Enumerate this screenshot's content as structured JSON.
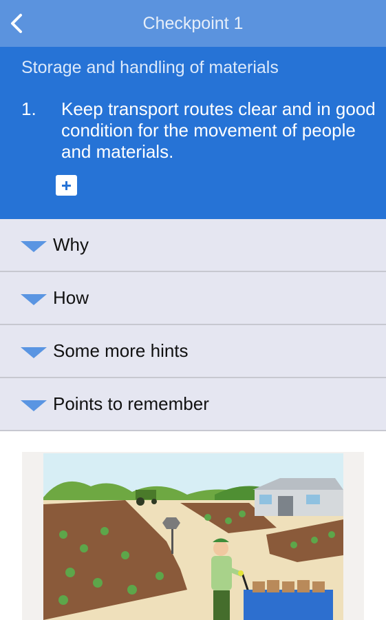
{
  "header": {
    "title": "Checkpoint 1"
  },
  "banner": {
    "section_title": "Storage and handling of materials",
    "item_number": "1.",
    "item_text": "Keep transport routes clear and in good condition for the movement of people and materials."
  },
  "accordion": [
    {
      "label": "Why"
    },
    {
      "label": "How"
    },
    {
      "label": "Some more hints"
    },
    {
      "label": "Points to remember"
    }
  ],
  "colors": {
    "header_bg": "#5b93de",
    "banner_bg": "#2673d6",
    "accordion_bg": "#e5e6f1",
    "arrow": "#5a95e2"
  },
  "icons": [
    "back-arrow-icon",
    "plus-icon",
    "expand-arrow-icon"
  ]
}
